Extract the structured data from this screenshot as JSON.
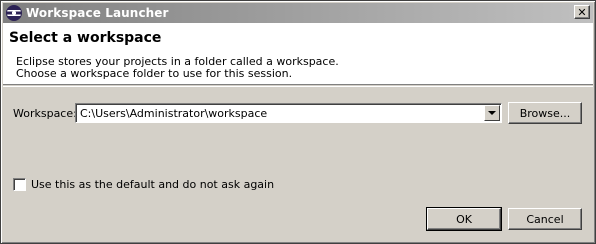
{
  "window": {
    "title": "Workspace Launcher",
    "close_glyph": "✕"
  },
  "header": {
    "heading": "Select a workspace",
    "description_line1": "Eclipse stores your projects in a folder called a workspace.",
    "description_line2": "Choose a workspace folder to use for this session."
  },
  "workspace": {
    "label": "Workspace:",
    "selected_value": "C:\\Users\\Administrator\\workspace",
    "browse_label": "Browse..."
  },
  "options": {
    "default_checkbox_label": "Use this as the default and do not ask again",
    "default_checked": false
  },
  "footer": {
    "ok_label": "OK",
    "cancel_label": "Cancel"
  },
  "colors": {
    "dialog_background": "#d4d0c8",
    "header_background": "#ffffff"
  },
  "icons": [
    "eclipse-logo-icon",
    "close-icon",
    "dropdown-arrow-icon"
  ]
}
